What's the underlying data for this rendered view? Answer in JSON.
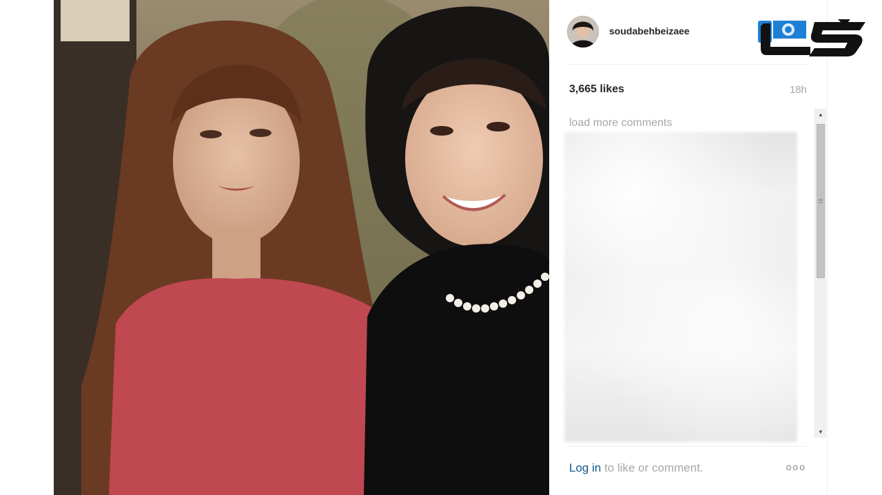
{
  "post": {
    "username": "soudabehbeizaee",
    "likes": "3,665 likes",
    "time": "18h",
    "load_more": "load more comments",
    "login_link": "Log in",
    "login_suffix": " to like or comment.",
    "more": "ooo"
  },
  "colors": {
    "link": "#125688",
    "muted": "#a5a7aa",
    "text": "#262626",
    "logo_blue": "#1e7fd6",
    "logo_black": "#111111"
  },
  "icons": {
    "avatar": "profile-photo",
    "more": "ellipsis-icon",
    "logo": "news-watermark-logo"
  }
}
